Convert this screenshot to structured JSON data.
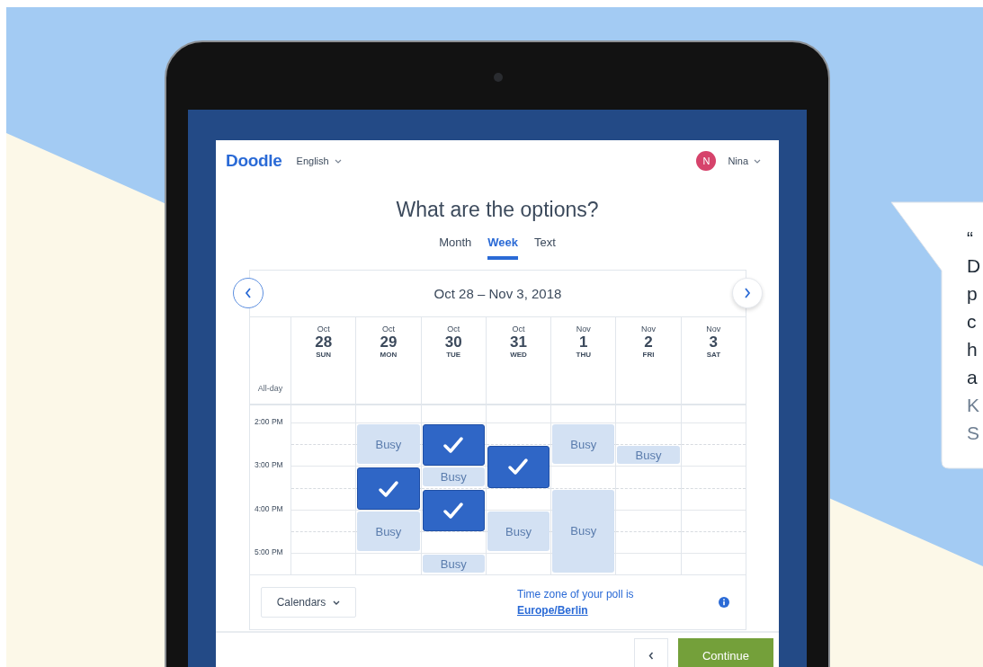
{
  "app": {
    "logo": "Doodle",
    "language": "English",
    "user": {
      "initial": "N",
      "name": "Nina"
    }
  },
  "title": "What are the options?",
  "tabs": [
    {
      "label": "Month",
      "selected": false
    },
    {
      "label": "Week",
      "selected": true
    },
    {
      "label": "Text",
      "selected": false
    }
  ],
  "calendar": {
    "range": "Oct 28 – Nov 3, 2018",
    "allday_label": "All-day",
    "times": [
      "2:00 PM",
      "3:00 PM",
      "4:00 PM",
      "5:00 PM"
    ],
    "days": [
      {
        "month": "Oct",
        "date": "28",
        "weekday": "SUN",
        "slots": [
          {
            "kind": "free"
          },
          {
            "kind": "free"
          },
          {
            "kind": "free"
          },
          {
            "kind": "free"
          },
          {
            "kind": "free"
          },
          {
            "kind": "free"
          },
          {
            "kind": "free"
          },
          {
            "kind": "free"
          }
        ]
      },
      {
        "month": "Oct",
        "date": "29",
        "weekday": "MON",
        "slots": [
          {
            "kind": "busy",
            "label": "Busy"
          },
          {
            "kind": "continued"
          },
          {
            "kind": "selected"
          },
          {
            "kind": "continued"
          },
          {
            "kind": "busy",
            "label": "Busy"
          },
          {
            "kind": "continued"
          },
          {
            "kind": "free"
          },
          {
            "kind": "free"
          }
        ]
      },
      {
        "month": "Oct",
        "date": "30",
        "weekday": "TUE",
        "slots": [
          {
            "kind": "selected"
          },
          {
            "kind": "continued"
          },
          {
            "kind": "busy",
            "label": "Busy"
          },
          {
            "kind": "selected"
          },
          {
            "kind": "continued"
          },
          {
            "kind": "free"
          },
          {
            "kind": "busy",
            "label": "Busy"
          },
          {
            "kind": "free"
          }
        ]
      },
      {
        "month": "Oct",
        "date": "31",
        "weekday": "WED",
        "slots": [
          {
            "kind": "free"
          },
          {
            "kind": "selected"
          },
          {
            "kind": "continued"
          },
          {
            "kind": "free"
          },
          {
            "kind": "busy",
            "label": "Busy"
          },
          {
            "kind": "continued"
          },
          {
            "kind": "free"
          },
          {
            "kind": "free"
          }
        ]
      },
      {
        "month": "Nov",
        "date": "1",
        "weekday": "THU",
        "slots": [
          {
            "kind": "busy",
            "label": "Busy"
          },
          {
            "kind": "continued"
          },
          {
            "kind": "free"
          },
          {
            "kind": "busy",
            "label": "Busy"
          },
          {
            "kind": "continued"
          },
          {
            "kind": "continued"
          },
          {
            "kind": "continued"
          },
          {
            "kind": "free"
          }
        ]
      },
      {
        "month": "Nov",
        "date": "2",
        "weekday": "FRI",
        "slots": [
          {
            "kind": "free"
          },
          {
            "kind": "busy",
            "label": "Busy"
          },
          {
            "kind": "free"
          },
          {
            "kind": "free"
          },
          {
            "kind": "free"
          },
          {
            "kind": "free"
          },
          {
            "kind": "free"
          },
          {
            "kind": "free"
          }
        ]
      },
      {
        "month": "Nov",
        "date": "3",
        "weekday": "SAT",
        "slots": [
          {
            "kind": "free"
          },
          {
            "kind": "free"
          },
          {
            "kind": "free"
          },
          {
            "kind": "free"
          },
          {
            "kind": "free"
          },
          {
            "kind": "free"
          },
          {
            "kind": "free"
          },
          {
            "kind": "free"
          }
        ]
      }
    ]
  },
  "calendars_button": "Calendars",
  "timezone": {
    "text": "Time zone of your poll is",
    "link": "Europe/Berlin"
  },
  "footer": {
    "continue": "Continue"
  },
  "quote": {
    "lines": [
      "“",
      "D",
      "p",
      "c",
      "h",
      "a"
    ],
    "attribution": [
      "K",
      "S"
    ]
  }
}
